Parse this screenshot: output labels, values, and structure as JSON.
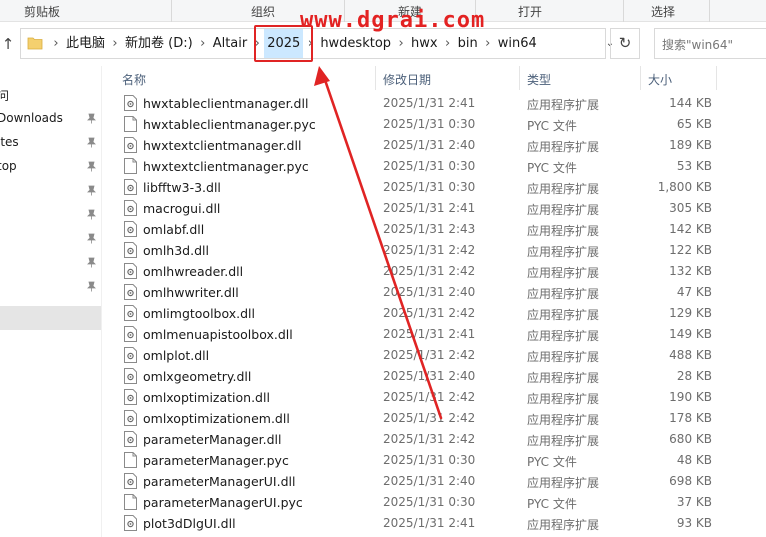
{
  "ribbon": {
    "groups": [
      "剪贴板",
      "组织",
      "新建",
      "打开",
      "选择"
    ]
  },
  "address": {
    "crumbs": [
      "此电脑",
      "新加卷 (D:)",
      "Altair",
      "2025",
      "hwdesktop",
      "hwx",
      "bin",
      "win64"
    ],
    "highlighted_crumb": "2025",
    "search_placeholder": "搜索\"win64\""
  },
  "watermark": "www.dgrai.com",
  "nav": {
    "items": [
      {
        "label": "问",
        "pinned": false
      },
      {
        "label": "Downloads",
        "pinned": true
      },
      {
        "label": "ites",
        "pinned": true
      },
      {
        "label": "top",
        "pinned": true
      },
      {
        "label": "",
        "pinned": true
      },
      {
        "label": "",
        "pinned": true
      },
      {
        "label": "",
        "pinned": true
      },
      {
        "label": "i",
        "pinned": true
      },
      {
        "label": "",
        "pinned": true
      },
      {
        "label": "",
        "pinned": false,
        "selected": true
      }
    ]
  },
  "columns": {
    "name": "名称",
    "date": "修改日期",
    "type": "类型",
    "size": "大小"
  },
  "files": [
    {
      "name": "hwxtableclientmanager.dll",
      "date": "2025/1/31 2:41",
      "type": "应用程序扩展",
      "size": "144 KB",
      "icon": "dll-icon"
    },
    {
      "name": "hwxtableclientmanager.pyc",
      "date": "2025/1/31 0:30",
      "type": "PYC 文件",
      "size": "65 KB",
      "icon": "file-icon"
    },
    {
      "name": "hwxtextclientmanager.dll",
      "date": "2025/1/31 2:40",
      "type": "应用程序扩展",
      "size": "189 KB",
      "icon": "dll-icon"
    },
    {
      "name": "hwxtextclientmanager.pyc",
      "date": "2025/1/31 0:30",
      "type": "PYC 文件",
      "size": "53 KB",
      "icon": "file-icon"
    },
    {
      "name": "libfftw3-3.dll",
      "date": "2025/1/31 0:30",
      "type": "应用程序扩展",
      "size": "1,800 KB",
      "icon": "dll-icon"
    },
    {
      "name": "macrogui.dll",
      "date": "2025/1/31 2:41",
      "type": "应用程序扩展",
      "size": "305 KB",
      "icon": "dll-icon"
    },
    {
      "name": "omlabf.dll",
      "date": "2025/1/31 2:43",
      "type": "应用程序扩展",
      "size": "142 KB",
      "icon": "dll-icon"
    },
    {
      "name": "omlh3d.dll",
      "date": "2025/1/31 2:42",
      "type": "应用程序扩展",
      "size": "122 KB",
      "icon": "dll-icon"
    },
    {
      "name": "omlhwreader.dll",
      "date": "2025/1/31 2:42",
      "type": "应用程序扩展",
      "size": "132 KB",
      "icon": "dll-icon"
    },
    {
      "name": "omlhwwriter.dll",
      "date": "2025/1/31 2:40",
      "type": "应用程序扩展",
      "size": "47 KB",
      "icon": "dll-icon"
    },
    {
      "name": "omlimgtoolbox.dll",
      "date": "2025/1/31 2:42",
      "type": "应用程序扩展",
      "size": "129 KB",
      "icon": "dll-icon"
    },
    {
      "name": "omlmenuapistoolbox.dll",
      "date": "2025/1/31 2:41",
      "type": "应用程序扩展",
      "size": "149 KB",
      "icon": "dll-icon"
    },
    {
      "name": "omlplot.dll",
      "date": "2025/1/31 2:42",
      "type": "应用程序扩展",
      "size": "488 KB",
      "icon": "dll-icon"
    },
    {
      "name": "omlxgeometry.dll",
      "date": "2025/1/31 2:40",
      "type": "应用程序扩展",
      "size": "28 KB",
      "icon": "dll-icon"
    },
    {
      "name": "omlxoptimization.dll",
      "date": "2025/1/31 2:42",
      "type": "应用程序扩展",
      "size": "190 KB",
      "icon": "dll-icon"
    },
    {
      "name": "omlxoptimizationem.dll",
      "date": "2025/1/31 2:42",
      "type": "应用程序扩展",
      "size": "178 KB",
      "icon": "dll-icon"
    },
    {
      "name": "parameterManager.dll",
      "date": "2025/1/31 2:42",
      "type": "应用程序扩展",
      "size": "680 KB",
      "icon": "dll-icon"
    },
    {
      "name": "parameterManager.pyc",
      "date": "2025/1/31 0:30",
      "type": "PYC 文件",
      "size": "48 KB",
      "icon": "file-icon"
    },
    {
      "name": "parameterManagerUI.dll",
      "date": "2025/1/31 2:40",
      "type": "应用程序扩展",
      "size": "698 KB",
      "icon": "dll-icon"
    },
    {
      "name": "parameterManagerUI.pyc",
      "date": "2025/1/31 0:30",
      "type": "PYC 文件",
      "size": "37 KB",
      "icon": "file-icon"
    },
    {
      "name": "plot3dDlgUI.dll",
      "date": "2025/1/31 2:41",
      "type": "应用程序扩展",
      "size": "93 KB",
      "icon": "dll-icon"
    }
  ],
  "colors": {
    "annotation": "#e02424",
    "crumb_highlight": "#cce8ff",
    "selected_nav": "#e5e5e5",
    "header_text": "#4c607a"
  }
}
